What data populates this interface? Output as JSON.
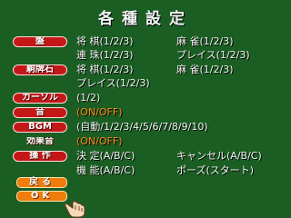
{
  "title": "各種設定",
  "rows": [
    {
      "label": "盤",
      "c1": "将 棋(1/2/3)",
      "c2": "麻 雀(1/2/3)"
    },
    {
      "label": "",
      "c1": "連 珠(1/2/3)",
      "c2": "プレイス(1/2/3)"
    },
    {
      "label": "駒牌石",
      "c1": "将 棋(1/2/3)",
      "c2": "麻 雀(1/2/3)"
    },
    {
      "label": "",
      "c1": "プレイス(1/2/3)",
      "c2": ""
    },
    {
      "label": "カーソル",
      "c1": "(1/2)",
      "c2": ""
    },
    {
      "label": "音",
      "c1": "(ON/OFF)",
      "c2": ""
    },
    {
      "label": "BGM",
      "c1": "(自動/1/2/3/4/5/6/7/8/9/10)",
      "c2": ""
    },
    {
      "label": "効果音",
      "c1": "(ON/OFF)",
      "c2": ""
    },
    {
      "label": "操 作",
      "c1": "決 定(A/B/C)",
      "c2": "キャンセル(A/B/C)"
    },
    {
      "label": "",
      "c1": "機 能(A/B/C)",
      "c2": "ポーズ(スタート)"
    }
  ],
  "buttons": {
    "back": "戻る",
    "ok": "OK"
  },
  "colors": {
    "background": "#1b5e23",
    "label_bg": "#c41818",
    "button_bg": "#ee7d0c",
    "selected_text": "#ff8a1a"
  },
  "cursor_icon": "pointing-hand-icon"
}
